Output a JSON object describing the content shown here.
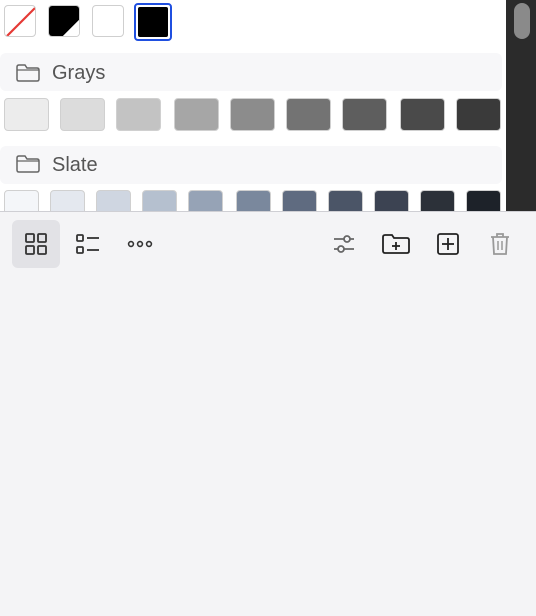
{
  "top_swatches": [
    {
      "name": "none",
      "color": "none"
    },
    {
      "name": "black-white-split",
      "color": "#000000"
    },
    {
      "name": "white",
      "color": "#ffffff"
    },
    {
      "name": "black-selected",
      "color": "#000000"
    }
  ],
  "selected_outline_color": "#1f4fe0",
  "groups": [
    {
      "label": "Grays",
      "icon": "folder-icon",
      "colors": [
        "#ececec",
        "#dcdcdc",
        "#c3c3c3",
        "#a6a6a6",
        "#8c8c8c",
        "#737373",
        "#5e5e5e",
        "#4a4a4a",
        "#3a3a3a"
      ]
    },
    {
      "label": "Slate",
      "icon": "folder-icon",
      "colors": [
        "#f4f6f9",
        "#e4e8ef",
        "#cfd6e1",
        "#b5c0cf",
        "#96a3b6",
        "#7a889d",
        "#5f6b80",
        "#4b5567",
        "#3c4352",
        "#2c3139",
        "#1d2229"
      ]
    }
  ],
  "toolbar": {
    "left": [
      {
        "name": "grid-view-button",
        "icon": "grid-icon",
        "active": true
      },
      {
        "name": "list-view-button",
        "icon": "list-icon",
        "active": false
      },
      {
        "name": "more-button",
        "icon": "more-icon",
        "active": false
      }
    ],
    "right": [
      {
        "name": "adjust-button",
        "icon": "sliders-icon"
      },
      {
        "name": "new-folder-button",
        "icon": "folder-plus-icon"
      },
      {
        "name": "add-swatch-button",
        "icon": "plus-square-icon"
      },
      {
        "name": "delete-button",
        "icon": "trash-icon"
      }
    ]
  }
}
